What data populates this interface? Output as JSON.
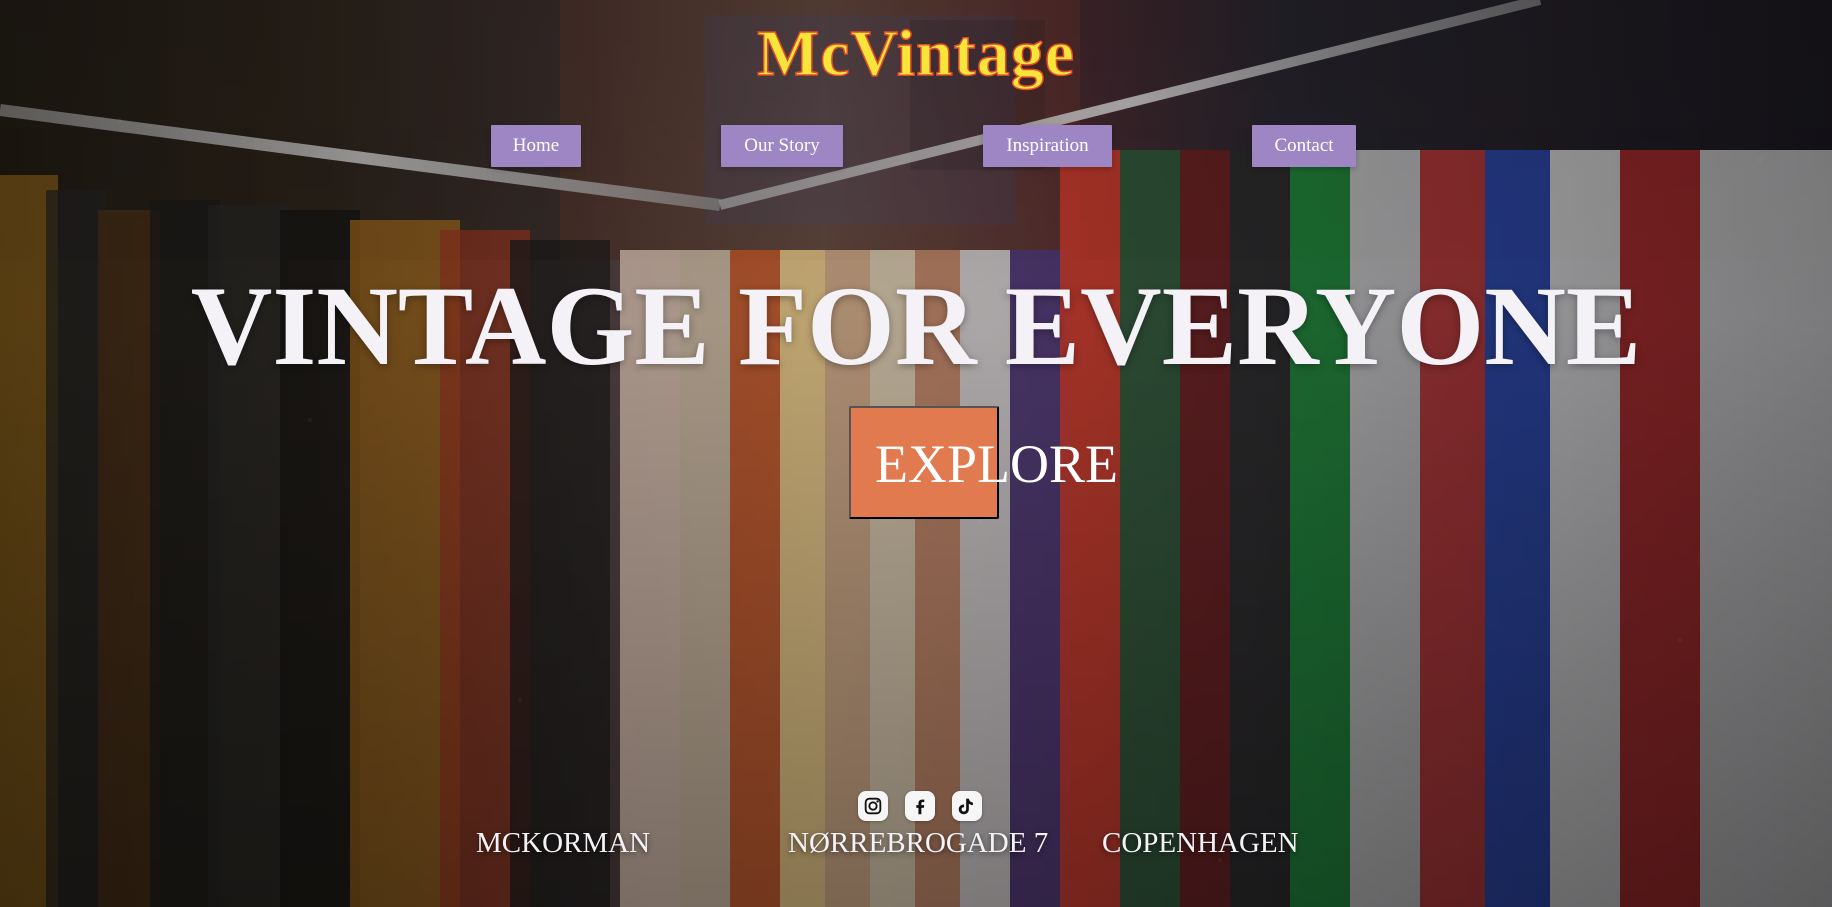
{
  "brand": {
    "name": "McVintage"
  },
  "nav": {
    "items": [
      {
        "label": "Home"
      },
      {
        "label": "Our Story"
      },
      {
        "label": "Inspiration"
      },
      {
        "label": "Contact"
      }
    ]
  },
  "hero": {
    "headline": "VINTAGE FOR EVERYONE",
    "cta_label": "EXPLORE"
  },
  "socials": {
    "icons": [
      "instagram-icon",
      "facebook-icon",
      "tiktok-icon"
    ]
  },
  "footer": {
    "items": [
      {
        "text": "MCKORMAN"
      },
      {
        "text": "NØRREBROGADE 7"
      },
      {
        "text": "COPENHAGEN"
      }
    ]
  },
  "colors": {
    "brand_fill": "#f7e53a",
    "brand_stroke": "#e44a2a",
    "nav_button": "#9d86c3",
    "cta_button": "#e27a4f",
    "text_light": "#f4f2f6"
  }
}
